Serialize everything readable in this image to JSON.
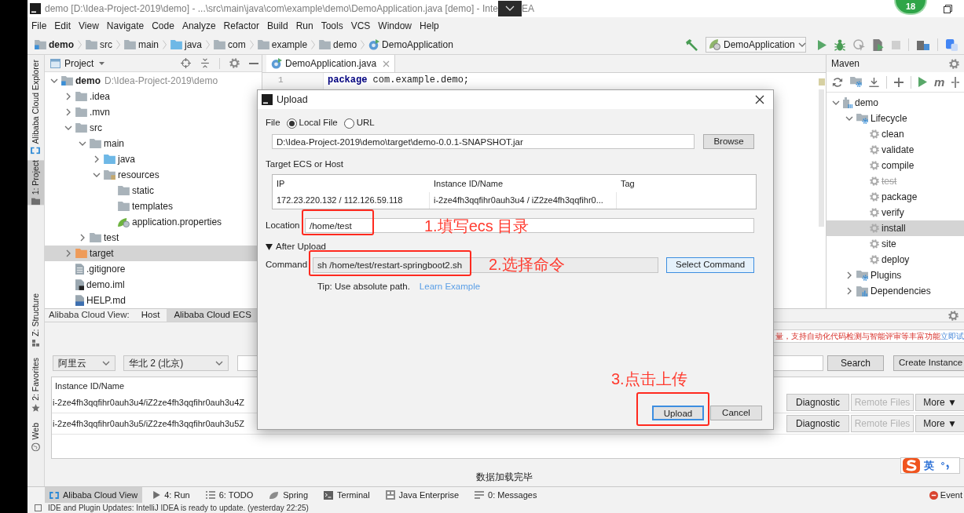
{
  "window": {
    "title": "demo [D:\\Idea-Project-2019\\demo] - ...\\src\\main\\java\\com\\example\\demo\\DemoApplication.java [demo] - Inte",
    "title_after_overlay": "EA",
    "floating_badge": "18"
  },
  "menu": [
    "File",
    "Edit",
    "View",
    "Navigate",
    "Code",
    "Analyze",
    "Refactor",
    "Build",
    "Run",
    "Tools",
    "VCS",
    "Window",
    "Help"
  ],
  "breadcrumbs": [
    {
      "label": "demo",
      "kind": "module"
    },
    {
      "label": "src",
      "kind": "folder"
    },
    {
      "label": "main",
      "kind": "folder"
    },
    {
      "label": "java",
      "kind": "source"
    },
    {
      "label": "com",
      "kind": "package"
    },
    {
      "label": "example",
      "kind": "package"
    },
    {
      "label": "demo",
      "kind": "package"
    },
    {
      "label": "DemoApplication",
      "kind": "class"
    }
  ],
  "run_configuration": "DemoApplication",
  "left_strip_top": [
    {
      "label": "Alibaba Cloud Explorer",
      "kind": "cloud",
      "selected": false
    },
    {
      "label": "1: Project",
      "kind": "project",
      "selected": true
    }
  ],
  "left_strip_bottom": [
    {
      "label": "Z: Structure",
      "kind": "structure",
      "selected": false
    },
    {
      "label": "2: Favorites",
      "kind": "favorites",
      "selected": false
    },
    {
      "label": "Web",
      "kind": "web",
      "selected": false
    }
  ],
  "project": {
    "title": "Project",
    "tree": [
      {
        "label": "demo",
        "path": "D:\\Idea-Project-2019\\demo",
        "kind": "module",
        "expanded": true,
        "selected": false,
        "children": [
          {
            "label": ".idea",
            "kind": "folder",
            "expanded": false,
            "selected": false
          },
          {
            "label": ".mvn",
            "kind": "folder",
            "expanded": false,
            "selected": false
          },
          {
            "label": "src",
            "kind": "folder",
            "expanded": true,
            "selected": false,
            "children": [
              {
                "label": "main",
                "kind": "folder",
                "expanded": true,
                "selected": false,
                "children": [
                  {
                    "label": "java",
                    "kind": "source",
                    "expanded": false,
                    "selected": false
                  },
                  {
                    "label": "resources",
                    "kind": "resources",
                    "expanded": true,
                    "selected": false,
                    "children": [
                      {
                        "label": "static",
                        "kind": "folder",
                        "selected": false
                      },
                      {
                        "label": "templates",
                        "kind": "folder",
                        "selected": false
                      },
                      {
                        "label": "application.properties",
                        "kind": "properties",
                        "selected": false
                      }
                    ]
                  }
                ]
              },
              {
                "label": "test",
                "kind": "folder",
                "expanded": false,
                "selected": false
              }
            ]
          },
          {
            "label": "target",
            "kind": "excluded",
            "expanded": false,
            "selected": true
          },
          {
            "label": ".gitignore",
            "kind": "text",
            "selected": false
          },
          {
            "label": "demo.iml",
            "kind": "iml",
            "selected": false
          },
          {
            "label": "HELP.md",
            "kind": "markdown",
            "selected": false
          }
        ]
      }
    ]
  },
  "editor": {
    "tabs": [
      {
        "label": "DemoApplication.java",
        "selected": true
      }
    ],
    "lines": [
      {
        "number": "1",
        "code": "**package** com.example.demo;"
      }
    ]
  },
  "maven": {
    "title": "Maven",
    "toolbar_glyph": "m",
    "tree": [
      {
        "label": "demo",
        "kind": "project",
        "expanded": true,
        "selected": false,
        "children": [
          {
            "label": "Lifecycle",
            "kind": "lifecycle",
            "expanded": true,
            "selected": false,
            "children": [
              {
                "label": "clean",
                "kind": "goal",
                "selected": false,
                "disabled": false
              },
              {
                "label": "validate",
                "kind": "goal",
                "selected": false,
                "disabled": false
              },
              {
                "label": "compile",
                "kind": "goal",
                "selected": false,
                "disabled": false
              },
              {
                "label": "test",
                "kind": "goal",
                "selected": false,
                "disabled": true
              },
              {
                "label": "package",
                "kind": "goal",
                "selected": false,
                "disabled": false
              },
              {
                "label": "verify",
                "kind": "goal",
                "selected": false,
                "disabled": false
              },
              {
                "label": "install",
                "kind": "goal",
                "selected": true,
                "disabled": false
              },
              {
                "label": "site",
                "kind": "goal",
                "selected": false,
                "disabled": false
              },
              {
                "label": "deploy",
                "kind": "goal",
                "selected": false,
                "disabled": false
              }
            ]
          },
          {
            "label": "Plugins",
            "kind": "plugins",
            "expanded": false,
            "selected": false
          },
          {
            "label": "Dependencies",
            "kind": "dependencies",
            "expanded": false,
            "selected": false
          }
        ]
      }
    ]
  },
  "cloud_view": {
    "title": "Alibaba Cloud View:",
    "tabs": [
      {
        "label": "Host",
        "selected": false
      },
      {
        "label": "Alibaba Cloud ECS",
        "selected": true
      }
    ],
    "notice": "量，支持自动化代码检测与智能评审等丰富功能",
    "notice_link": "立即试",
    "provider": "阿里云",
    "region": "华北 2 (北京)",
    "search_button": "Search",
    "create_button": "Create Instance",
    "columns": [
      "Instance ID/Name"
    ],
    "rows": [
      {
        "name": "i-2ze4fh3qqfihr0auh3u4/iZ2ze4fh3qqfihr0auh3u4Z",
        "actions": [
          {
            "label": "Diagnostic",
            "disabled": false
          },
          {
            "label": "Remote Files",
            "disabled": true
          },
          {
            "label": "More ▼",
            "disabled": false
          }
        ]
      },
      {
        "name": "i-2ze4fh3qqfihr0auh3u5/iZ2ze4fh3qqfihr0auh3u5Z",
        "actions": [
          {
            "label": "Diagnostic",
            "disabled": false
          },
          {
            "label": "Remote Files",
            "disabled": true
          },
          {
            "label": "More ▼",
            "disabled": false
          }
        ]
      }
    ],
    "status": "数据加载完毕"
  },
  "ime": {
    "mode": "英"
  },
  "tool_windows": [
    {
      "label": "Alibaba Cloud View",
      "kind": "cloud",
      "selected": true
    },
    {
      "label": "4: Run",
      "kind": "run",
      "selected": false
    },
    {
      "label": "6: TODO",
      "kind": "todo",
      "selected": false
    },
    {
      "label": "Spring",
      "kind": "spring",
      "selected": false
    },
    {
      "label": "Terminal",
      "kind": "terminal",
      "selected": false
    },
    {
      "label": "Java Enterprise",
      "kind": "enterprise",
      "selected": false
    },
    {
      "label": "0: Messages",
      "kind": "messages",
      "selected": false
    }
  ],
  "event_log_button": "Event",
  "status_bar": {
    "message": "IDE and Plugin Updates: IntelliJ IDEA is ready to update. (yesterday 22:25)"
  },
  "upload_dialog": {
    "title": "Upload",
    "file_label": "File",
    "file_sources": [
      {
        "label": "Local File",
        "selected": true
      },
      {
        "label": "URL",
        "selected": false
      }
    ],
    "file_path": "D:\\Idea-Project-2019\\demo\\target\\demo-0.0.1-SNAPSHOT.jar",
    "browse_button": "Browse",
    "target_label": "Target ECS or Host",
    "target_columns": [
      "IP",
      "Instance ID/Name",
      "Tag"
    ],
    "target_rows": [
      {
        "ip": "172.23.220.132 / 112.126.59.118",
        "instance": "i-2ze4fh3qqfihr0auh3u4 / iZ2ze4fh3qqfihr0..."
      }
    ],
    "location_label": "Location",
    "location": "/home/test",
    "after_upload": {
      "label": "After Upload",
      "expanded": true
    },
    "command_label": "Command",
    "command": "sh /home/test/restart-springboot2.sh",
    "select_command_button": "Select Command",
    "tip": "Tip: Use absolute path.",
    "tip_link": "Learn Example",
    "buttons": [
      {
        "label": "Upload",
        "kind": "default"
      },
      {
        "label": "Cancel",
        "kind": "normal"
      }
    ]
  },
  "annotations": [
    {
      "text": "1.填写ecs 目录"
    },
    {
      "text": "2.选择命令"
    },
    {
      "text": "3.点击上传"
    }
  ]
}
